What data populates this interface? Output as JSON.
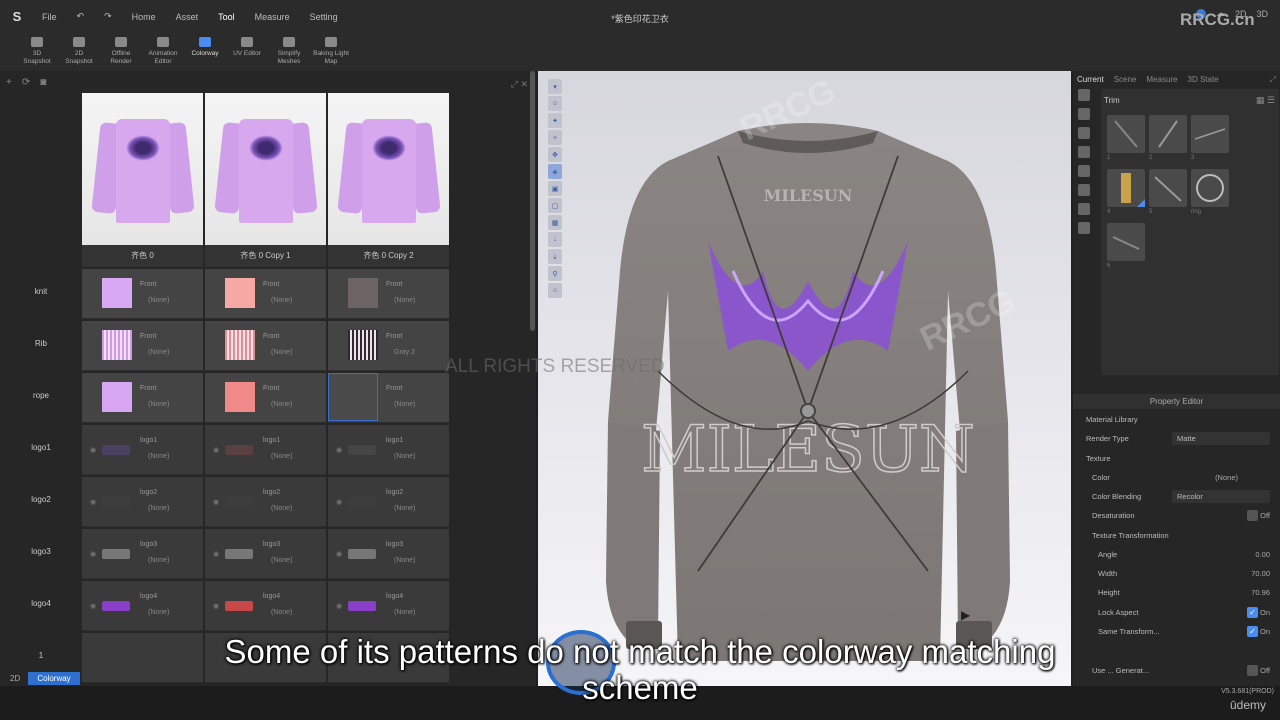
{
  "title_bar": {
    "logo": "S",
    "file_menu": "File",
    "menus": [
      "Home",
      "Asset",
      "Tool",
      "Measure",
      "Setting"
    ],
    "active_menu": "Tool",
    "doc_title": "*紫色印花卫衣",
    "right_items": [
      "2D",
      "3D",
      "??"
    ],
    "brand": "RRCG.cn"
  },
  "toolbar": [
    {
      "l1": "3D",
      "l2": "Snapshot",
      "icon": "camera-icon"
    },
    {
      "l1": "2D",
      "l2": "Snapshot",
      "icon": "snapshot-2d-icon"
    },
    {
      "l1": "Offline",
      "l2": "Render",
      "icon": "render-icon"
    },
    {
      "l1": "Animation",
      "l2": "Editor",
      "icon": "animation-icon"
    },
    {
      "l1": "Colorway",
      "l2": "",
      "icon": "colorway-icon"
    },
    {
      "l1": "UV Editor",
      "l2": "",
      "icon": "uv-icon"
    },
    {
      "l1": "Simplify",
      "l2": "Meshes",
      "icon": "mesh-icon"
    },
    {
      "l1": "Baking Light",
      "l2": "Map",
      "icon": "light-icon"
    }
  ],
  "colorway": {
    "columns": [
      "齐色 0",
      "齐色 0 Copy 1",
      "齐色 0 Copy 2"
    ],
    "rows": [
      {
        "label": "knit",
        "cells": [
          {
            "l1": "Front",
            "l2": "(None)",
            "color": "#d9a8f5"
          },
          {
            "l1": "Front",
            "l2": "(None)",
            "color": "#f5a8a4"
          },
          {
            "l1": "Front",
            "l2": "(None)",
            "color": "#6c6462"
          }
        ]
      },
      {
        "label": "Rib",
        "cells": [
          {
            "l1": "Front",
            "l2": "(None)",
            "color": "#d09ae8"
          },
          {
            "l1": "Front",
            "l2": "(None)",
            "color": "#e0908c"
          },
          {
            "l1": "Front",
            "l2": "Gray 2",
            "color": "#2a2a2a"
          }
        ]
      },
      {
        "label": "rope",
        "cells": [
          {
            "l1": "Front",
            "l2": "(None)",
            "color": "#d7a6f3"
          },
          {
            "l1": "Front",
            "l2": "(None)",
            "color": "#ef8a88"
          },
          {
            "l1": "Front",
            "l2": "(None)",
            "color": "#4a4a4a"
          }
        ]
      },
      {
        "label": "logo1",
        "cells": [
          {
            "l1": "logo1",
            "l2": "(None)",
            "color": "#4a4060"
          },
          {
            "l1": "logo1",
            "l2": "(None)",
            "color": "#5a4040"
          },
          {
            "l1": "logo1",
            "l2": "(None)",
            "color": "#454545"
          }
        ]
      },
      {
        "label": "logo2",
        "cells": [
          {
            "l1": "logo2",
            "l2": "(None)",
            "color": "#3d3d3d"
          },
          {
            "l1": "logo2",
            "l2": "(None)",
            "color": "#3d3d3d"
          },
          {
            "l1": "logo2",
            "l2": "(None)",
            "color": "#3d3d3d"
          }
        ]
      },
      {
        "label": "logo3",
        "cells": [
          {
            "l1": "logo3",
            "l2": "(None)",
            "color": "#777777"
          },
          {
            "l1": "logo3",
            "l2": "(None)",
            "color": "#777777"
          },
          {
            "l1": "logo3",
            "l2": "(None)",
            "color": "#777777"
          }
        ]
      },
      {
        "label": "logo4",
        "cells": [
          {
            "l1": "logo4",
            "l2": "(None)",
            "color": "#8a3fc8"
          },
          {
            "l1": "logo4",
            "l2": "(None)",
            "color": "#c84848"
          },
          {
            "l1": "logo4",
            "l2": "(None)",
            "color": "#8a3fc8"
          }
        ]
      },
      {
        "label": "1",
        "cells": []
      }
    ]
  },
  "viewport": {
    "tee_text": "MILESUN",
    "watermark_text": "ALL RIGHTS RESERVED"
  },
  "right": {
    "tabs": [
      "Current",
      "Scene",
      "Measure",
      "3D State"
    ],
    "trim_title": "Trim",
    "tile_labels": [
      "1",
      "2",
      "3",
      "4",
      "5",
      "ring",
      "6"
    ]
  },
  "property_editor": {
    "title": "Property Editor",
    "material_library": "Material Library",
    "render_type_label": "Render Type",
    "render_type": "Matte",
    "texture": "Texture",
    "color_label": "Color",
    "color_value": "(None)",
    "blending_label": "Color Blending",
    "blending_value": "Recolor",
    "desat_label": "Desaturation",
    "desat_value": "Off",
    "tt_label": "Texture Transformation",
    "angle_label": "Angle",
    "angle": "0.00",
    "width_label": "Width",
    "width": "70.00",
    "height_label": "Height",
    "height": "70.96",
    "lock_label": "Lock Aspect",
    "lock": "On",
    "same_label": "Same Transform...",
    "same": "On",
    "use_label": "Use ... Generat...",
    "use": "Off"
  },
  "bottom": {
    "tab_2d": "2D",
    "tab_colorway": "Colorway",
    "version": "V5.3.681(PROD)",
    "udemy": "ūdemy"
  },
  "subtitle": {
    "line1": "Some of its patterns do not match the colorway matching",
    "line2": "scheme"
  }
}
